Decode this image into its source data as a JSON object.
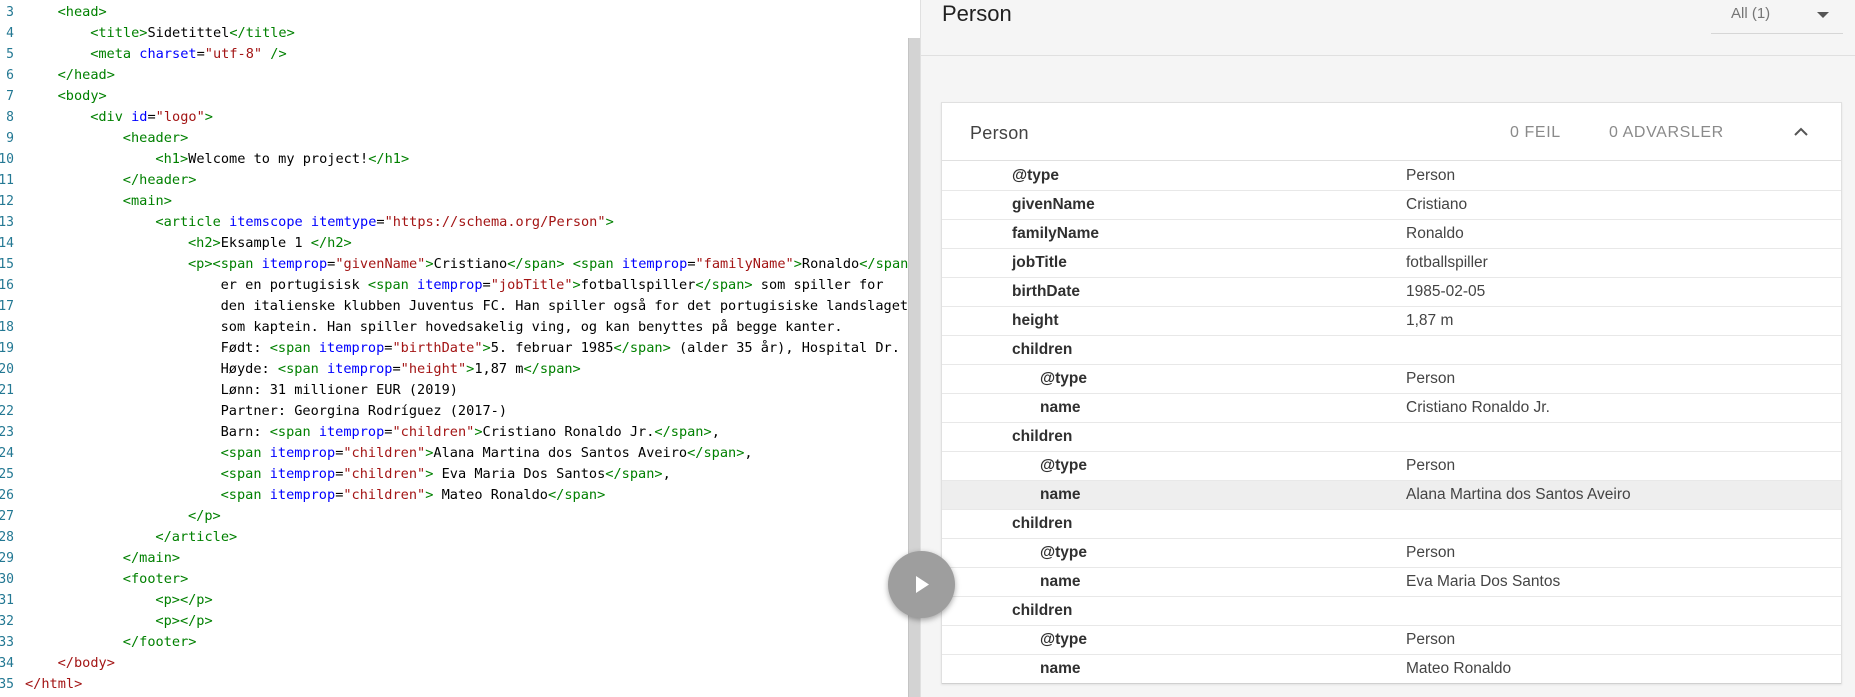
{
  "editor": {
    "lines": [
      {
        "n": "3",
        "indent": 1,
        "tokens": [
          [
            "tag",
            "<head>"
          ]
        ]
      },
      {
        "n": "4",
        "indent": 2,
        "tokens": [
          [
            "tag",
            "<title>"
          ],
          [
            "txt",
            "Sidetittel"
          ],
          [
            "tag",
            "</title>"
          ]
        ]
      },
      {
        "n": "5",
        "indent": 2,
        "tokens": [
          [
            "tag",
            "<meta "
          ],
          [
            "attr",
            "charset"
          ],
          [
            "txt",
            "="
          ],
          [
            "str",
            "\"utf-8\""
          ],
          [
            "tag",
            " />"
          ]
        ]
      },
      {
        "n": "6",
        "indent": 1,
        "tokens": [
          [
            "tag",
            "</head>"
          ]
        ]
      },
      {
        "n": "7",
        "indent": 1,
        "tokens": [
          [
            "tag",
            "<body>"
          ]
        ]
      },
      {
        "n": "8",
        "indent": 2,
        "tokens": [
          [
            "tag",
            "<div "
          ],
          [
            "attr",
            "id"
          ],
          [
            "txt",
            "="
          ],
          [
            "str",
            "\"logo\""
          ],
          [
            "tag",
            ">"
          ]
        ]
      },
      {
        "n": "9",
        "indent": 3,
        "tokens": [
          [
            "tag",
            "<header>"
          ]
        ]
      },
      {
        "n": "10",
        "indent": 4,
        "tokens": [
          [
            "tag",
            "<h1>"
          ],
          [
            "txt",
            "Welcome to my project!"
          ],
          [
            "tag",
            "</h1>"
          ]
        ]
      },
      {
        "n": "11",
        "indent": 3,
        "tokens": [
          [
            "tag",
            "</header>"
          ]
        ]
      },
      {
        "n": "12",
        "indent": 3,
        "tokens": [
          [
            "tag",
            "<main>"
          ]
        ]
      },
      {
        "n": "13",
        "indent": 4,
        "tokens": [
          [
            "tag",
            "<article "
          ],
          [
            "attr",
            "itemscope itemtype"
          ],
          [
            "txt",
            "="
          ],
          [
            "str",
            "\"https://schema.org/Person\""
          ],
          [
            "tag",
            ">"
          ]
        ]
      },
      {
        "n": "14",
        "indent": 5,
        "tokens": [
          [
            "tag",
            "<h2>"
          ],
          [
            "txt",
            "Eksample 1 "
          ],
          [
            "tag",
            "</h2>"
          ]
        ]
      },
      {
        "n": "15",
        "indent": 5,
        "tokens": [
          [
            "tag",
            "<p><span "
          ],
          [
            "attr",
            "itemprop"
          ],
          [
            "txt",
            "="
          ],
          [
            "str",
            "\"givenName\""
          ],
          [
            "tag",
            ">"
          ],
          [
            "txt",
            "Cristiano"
          ],
          [
            "tag",
            "</span>"
          ],
          [
            "txt",
            " "
          ],
          [
            "tag",
            "<span "
          ],
          [
            "attr",
            "itemprop"
          ],
          [
            "txt",
            "="
          ],
          [
            "str",
            "\"familyName\""
          ],
          [
            "tag",
            ">"
          ],
          [
            "txt",
            "Ronaldo"
          ],
          [
            "tag",
            "</span>"
          ]
        ]
      },
      {
        "n": "16",
        "indent": 6,
        "tokens": [
          [
            "txt",
            "er en portugisisk "
          ],
          [
            "tag",
            "<span "
          ],
          [
            "attr",
            "itemprop"
          ],
          [
            "txt",
            "="
          ],
          [
            "str",
            "\"jobTitle\""
          ],
          [
            "tag",
            ">"
          ],
          [
            "txt",
            "fotballspiller"
          ],
          [
            "tag",
            "</span>"
          ],
          [
            "txt",
            " som spiller for"
          ]
        ]
      },
      {
        "n": "17",
        "indent": 6,
        "tokens": [
          [
            "txt",
            "den italienske klubben Juventus FC. Han spiller også for det portugisiske landslaget"
          ]
        ]
      },
      {
        "n": "18",
        "indent": 6,
        "tokens": [
          [
            "txt",
            "som kaptein. Han spiller hovedsakelig ving, og kan benyttes på begge kanter."
          ]
        ]
      },
      {
        "n": "19",
        "indent": 6,
        "tokens": [
          [
            "txt",
            "Født: "
          ],
          [
            "tag",
            "<span "
          ],
          [
            "attr",
            "itemprop"
          ],
          [
            "txt",
            "="
          ],
          [
            "str",
            "\"birthDate\""
          ],
          [
            "tag",
            ">"
          ],
          [
            "txt",
            "5. februar 1985"
          ],
          [
            "tag",
            "</span>"
          ],
          [
            "txt",
            " (alder 35 år), Hospital Dr."
          ]
        ]
      },
      {
        "n": "20",
        "indent": 6,
        "tokens": [
          [
            "txt",
            "Høyde: "
          ],
          [
            "tag",
            "<span "
          ],
          [
            "attr",
            "itemprop"
          ],
          [
            "txt",
            "="
          ],
          [
            "str",
            "\"height\""
          ],
          [
            "tag",
            ">"
          ],
          [
            "txt",
            "1,87 m"
          ],
          [
            "tag",
            "</span>"
          ]
        ]
      },
      {
        "n": "21",
        "indent": 6,
        "tokens": [
          [
            "txt",
            "Lønn: 31 millioner EUR (2019)"
          ]
        ]
      },
      {
        "n": "22",
        "indent": 6,
        "tokens": [
          [
            "txt",
            "Partner: Georgina Rodríguez (2017-)"
          ]
        ]
      },
      {
        "n": "23",
        "indent": 6,
        "tokens": [
          [
            "txt",
            "Barn: "
          ],
          [
            "tag",
            "<span "
          ],
          [
            "attr",
            "itemprop"
          ],
          [
            "txt",
            "="
          ],
          [
            "str",
            "\"children\""
          ],
          [
            "tag",
            ">"
          ],
          [
            "txt",
            "Cristiano Ronaldo Jr."
          ],
          [
            "tag",
            "</span>"
          ],
          [
            "txt",
            ","
          ]
        ]
      },
      {
        "n": "24",
        "indent": 6,
        "tokens": [
          [
            "tag",
            "<span "
          ],
          [
            "attr",
            "itemprop"
          ],
          [
            "txt",
            "="
          ],
          [
            "str",
            "\"children\""
          ],
          [
            "tag",
            ">"
          ],
          [
            "txt",
            "Alana Martina dos Santos Aveiro"
          ],
          [
            "tag",
            "</span>"
          ],
          [
            "txt",
            ","
          ]
        ]
      },
      {
        "n": "25",
        "indent": 6,
        "tokens": [
          [
            "tag",
            "<span "
          ],
          [
            "attr",
            "itemprop"
          ],
          [
            "txt",
            "="
          ],
          [
            "str",
            "\"children\""
          ],
          [
            "tag",
            ">"
          ],
          [
            "txt",
            " Eva Maria Dos Santos"
          ],
          [
            "tag",
            "</span>"
          ],
          [
            "txt",
            ","
          ]
        ]
      },
      {
        "n": "26",
        "indent": 6,
        "tokens": [
          [
            "tag",
            "<span "
          ],
          [
            "attr",
            "itemprop"
          ],
          [
            "txt",
            "="
          ],
          [
            "str",
            "\"children\""
          ],
          [
            "tag",
            ">"
          ],
          [
            "txt",
            " Mateo Ronaldo"
          ],
          [
            "tag",
            "</span>"
          ]
        ]
      },
      {
        "n": "27",
        "indent": 5,
        "tokens": [
          [
            "tag",
            "</p>"
          ]
        ]
      },
      {
        "n": "28",
        "indent": 4,
        "tokens": [
          [
            "tag",
            "</article>"
          ]
        ]
      },
      {
        "n": "29",
        "indent": 3,
        "tokens": [
          [
            "tag",
            "</main>"
          ]
        ]
      },
      {
        "n": "30",
        "indent": 3,
        "tokens": [
          [
            "tag",
            "<footer>"
          ]
        ]
      },
      {
        "n": "31",
        "indent": 4,
        "tokens": [
          [
            "tag",
            "<p></p>"
          ]
        ]
      },
      {
        "n": "32",
        "indent": 4,
        "tokens": [
          [
            "tag",
            "<p></p>"
          ]
        ]
      },
      {
        "n": "33",
        "indent": 3,
        "tokens": [
          [
            "tag",
            "</footer>"
          ]
        ]
      },
      {
        "n": "34",
        "indent": 1,
        "tokens": [
          [
            "tag-red",
            "</body>"
          ]
        ]
      },
      {
        "n": "35",
        "indent": 0,
        "tokens": [
          [
            "tag-red",
            "</html>"
          ]
        ]
      }
    ]
  },
  "run_button": {
    "icon": "play-icon"
  },
  "results": {
    "title": "Person",
    "filter": {
      "value": "All (1)",
      "icon": "caret-down-icon"
    },
    "card": {
      "title": "Person",
      "errors": "0 FEIL",
      "warnings": "0 ADVARSLER",
      "collapse_icon": "chevron-up-icon",
      "rows": [
        {
          "key": "@type",
          "value": "Person",
          "level": 0
        },
        {
          "key": "givenName",
          "value": "Cristiano",
          "level": 0
        },
        {
          "key": "familyName",
          "value": "Ronaldo",
          "level": 0
        },
        {
          "key": "jobTitle",
          "value": "fotballspiller",
          "level": 0
        },
        {
          "key": "birthDate",
          "value": "1985-02-05",
          "level": 0
        },
        {
          "key": "height",
          "value": "1,87 m",
          "level": 0
        },
        {
          "key": "children",
          "value": "",
          "level": 0
        },
        {
          "key": "@type",
          "value": "Person",
          "level": 1
        },
        {
          "key": "name",
          "value": "Cristiano Ronaldo Jr.",
          "level": 1
        },
        {
          "key": "children",
          "value": "",
          "level": 0
        },
        {
          "key": "@type",
          "value": "Person",
          "level": 1
        },
        {
          "key": "name",
          "value": "Alana Martina dos Santos Aveiro",
          "level": 1,
          "highlighted": true
        },
        {
          "key": "children",
          "value": "",
          "level": 0
        },
        {
          "key": "@type",
          "value": "Person",
          "level": 1
        },
        {
          "key": "name",
          "value": "Eva Maria Dos Santos",
          "level": 1
        },
        {
          "key": "children",
          "value": "",
          "level": 0
        },
        {
          "key": "@type",
          "value": "Person",
          "level": 1
        },
        {
          "key": "name",
          "value": "Mateo Ronaldo",
          "level": 1
        }
      ]
    }
  },
  "colors": {
    "tag": "#008000",
    "attr": "#0000ff",
    "string": "#a31515",
    "run_button": "#9e9e9e",
    "highlight_row": "#eeeeee"
  }
}
